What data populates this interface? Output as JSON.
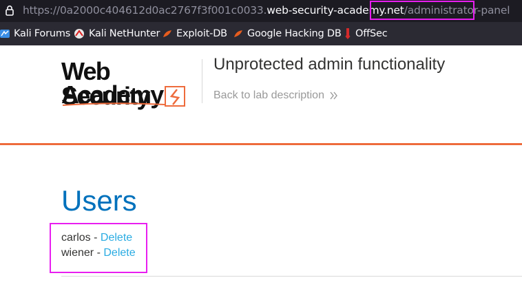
{
  "browser": {
    "url_scheme": "https://",
    "url_subdomain": "0a2000c404612d0ac2767f3f001c0033.",
    "url_domain": "web-security-academy.net",
    "url_path": "/administrator-panel",
    "bookmarks": [
      {
        "label": "Kali Forums",
        "icon": "kali-forums-icon"
      },
      {
        "label": "Kali NetHunter",
        "icon": "kali-nethunter-icon"
      },
      {
        "label": "Exploit-DB",
        "icon": "exploit-db-icon"
      },
      {
        "label": "Google Hacking DB",
        "icon": "google-hacking-db-icon"
      },
      {
        "label": "OffSec",
        "icon": "offsec-icon"
      }
    ]
  },
  "header": {
    "logo_line1": "Web Security",
    "logo_line2": "Academy",
    "lab_title": "Unprotected admin functionality",
    "back_link": "Back to lab description"
  },
  "main": {
    "heading": "Users",
    "users": [
      {
        "name": "carlos",
        "separator": " - ",
        "action": "Delete"
      },
      {
        "name": "wiener",
        "separator": " - ",
        "action": "Delete"
      }
    ]
  },
  "colors": {
    "accent_orange": "#ee6b3c",
    "heading_blue": "#0071bc",
    "link_blue": "#29abe2",
    "highlight_magenta": "#e81ef0"
  }
}
